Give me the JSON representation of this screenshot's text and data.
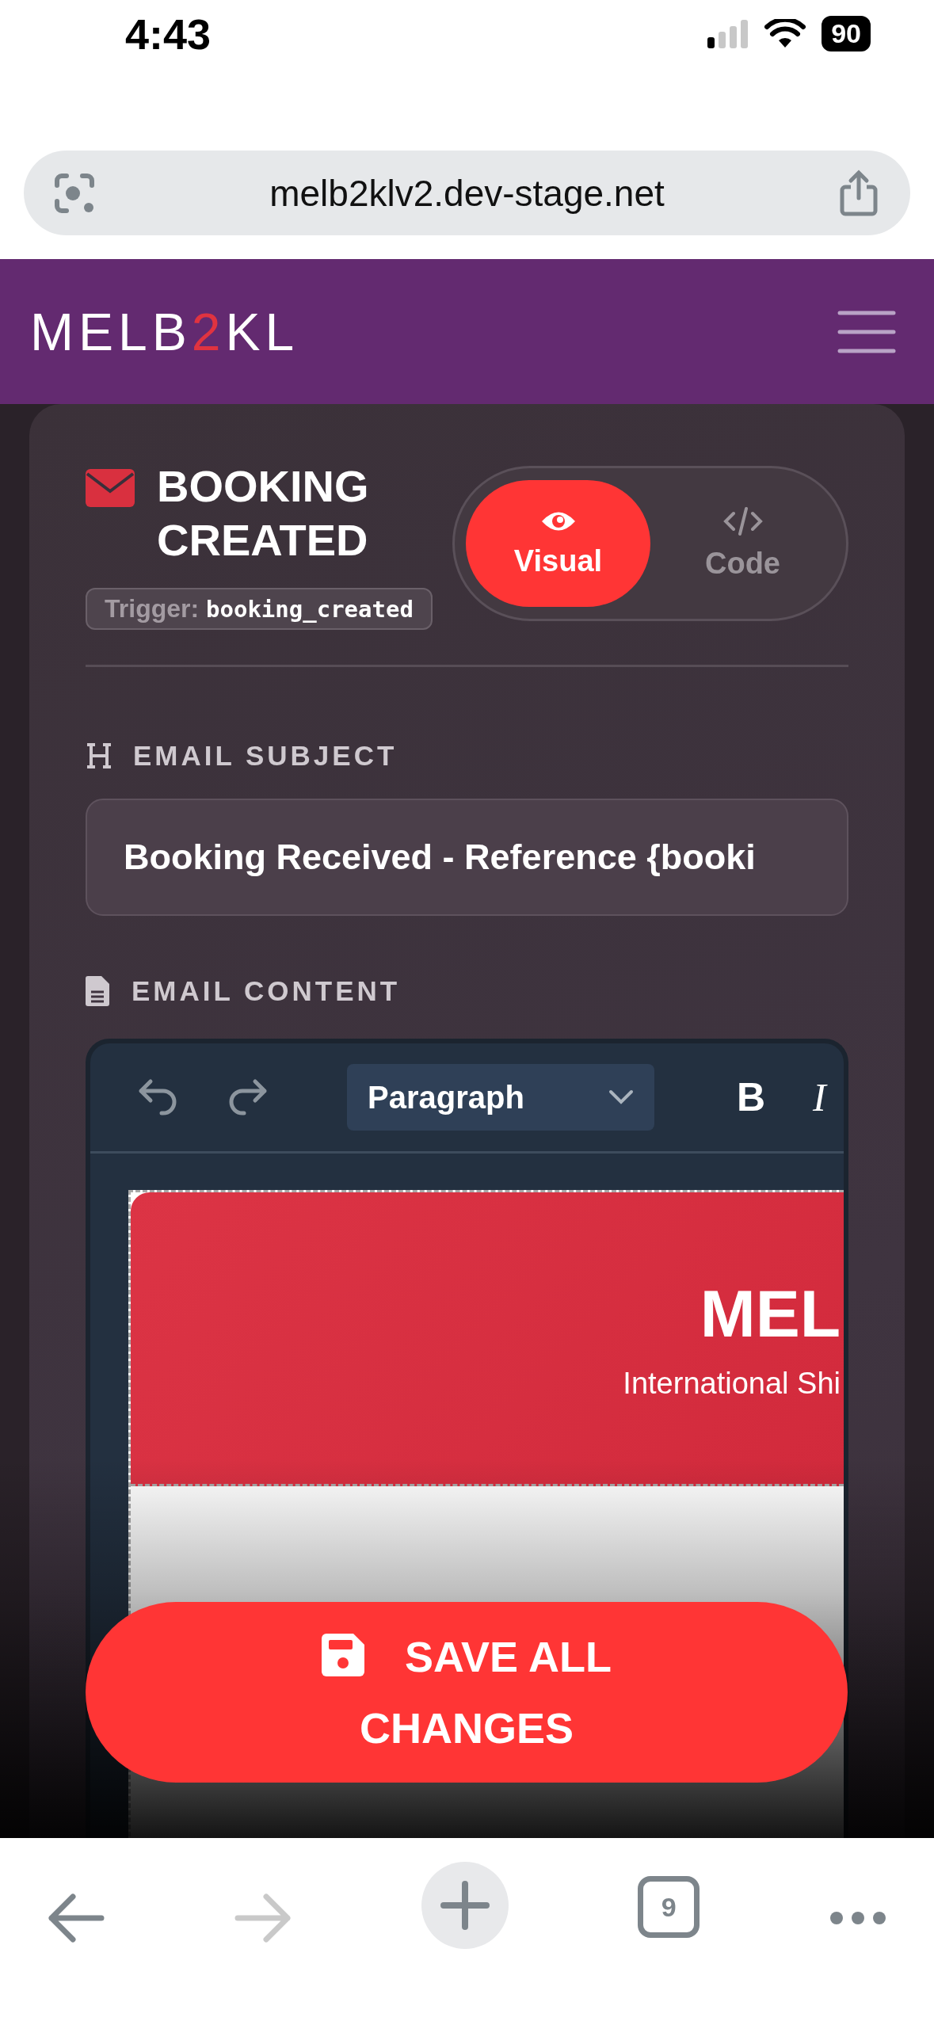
{
  "status_bar": {
    "time": "4:43",
    "battery": "90"
  },
  "browser": {
    "url": "melb2klv2.dev-stage.net",
    "tab_count": "9"
  },
  "header": {
    "logo": [
      {
        "text": "MELB",
        "accent": false
      },
      {
        "text": "2",
        "accent": true
      },
      {
        "text": "KL",
        "accent": false
      }
    ]
  },
  "template": {
    "title": "BOOKING CREATED",
    "trigger_label": "Trigger:",
    "trigger_value": "booking_created"
  },
  "view_modes": [
    {
      "label": "Visual",
      "kind": "visual",
      "selected": true
    },
    {
      "label": "Code",
      "kind": "code",
      "selected": false
    }
  ],
  "subject": {
    "label": "EMAIL SUBJECT",
    "value": "Booking Received - Reference {booki"
  },
  "content": {
    "label": "EMAIL CONTENT",
    "block_format": "Paragraph",
    "format_buttons": [
      {
        "label": "B",
        "kind": "bold"
      },
      {
        "label": "I",
        "kind": "italic"
      }
    ]
  },
  "email_preview": {
    "brand": "MEL",
    "tagline": "International Shi"
  },
  "save_button": "SAVE ALL CHANGES"
}
